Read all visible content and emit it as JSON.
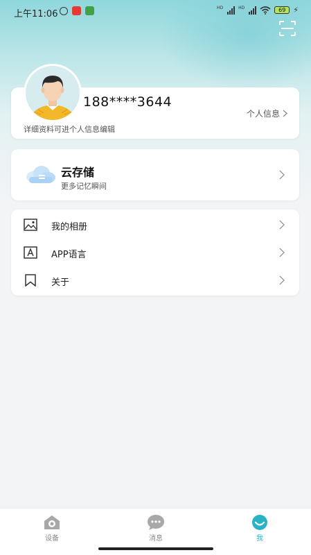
{
  "status_bar": {
    "time": "上午11:06",
    "signal_label_1": "HD",
    "signal_label_2": "HD",
    "battery": "69"
  },
  "header": {
    "scan_icon": "scan-icon"
  },
  "profile": {
    "phone": "188****3644",
    "link_label": "个人信息",
    "hint": "详细资料可进个人信息编辑"
  },
  "cloud": {
    "title": "云存储",
    "subtitle": "更多记忆瞬间",
    "icon": "cloud-icon"
  },
  "menu": {
    "items": [
      {
        "label": "我的相册",
        "icon": "image-icon"
      },
      {
        "label": "APP语言",
        "icon": "language-icon"
      },
      {
        "label": "关于",
        "icon": "bookmark-icon"
      }
    ]
  },
  "bottom_nav": {
    "items": [
      {
        "label": "设备",
        "icon": "camera-home-icon",
        "active": false
      },
      {
        "label": "消息",
        "icon": "message-icon",
        "active": false
      },
      {
        "label": "我",
        "icon": "profile-icon",
        "active": true
      }
    ]
  },
  "colors": {
    "accent": "#2ab3c4",
    "header_top": "#8fd7dc",
    "background": "#f3f4f6"
  }
}
